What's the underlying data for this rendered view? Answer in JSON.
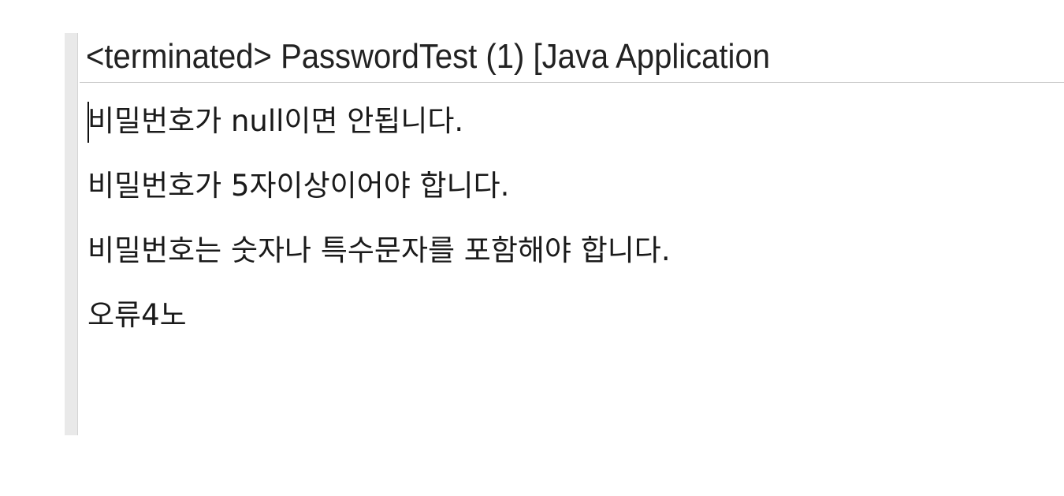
{
  "console": {
    "title": "<terminated> PasswordTest (1) [Java Application"
  },
  "output": {
    "lines": [
      "비밀번호가 null이면 안됩니다.",
      "비밀번호가 5자이상이어야 합니다.",
      "비밀번호는 숫자나 특수문자를 포함해야 합니다.",
      "오류4노"
    ]
  }
}
